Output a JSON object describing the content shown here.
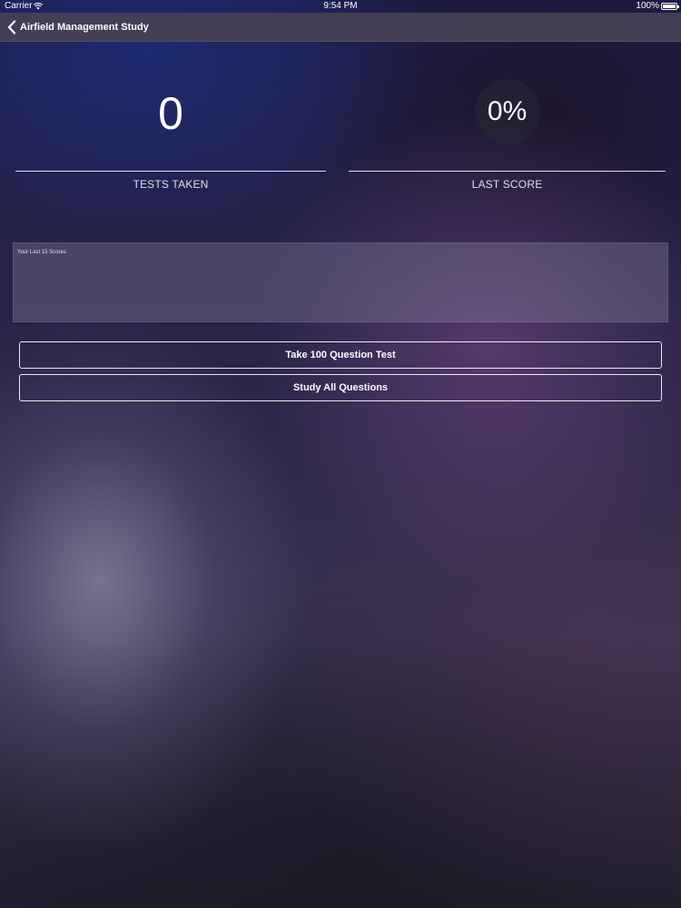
{
  "status_bar": {
    "carrier": "Carrier",
    "time": "9:54 PM",
    "battery": "100%"
  },
  "nav": {
    "back_label": "Airfield Management Study",
    "back_icon": "chevron-left-icon"
  },
  "stats": {
    "tests_taken_value": "0",
    "tests_taken_label": "TESTS TAKEN",
    "last_score_value": "0%",
    "last_score_label": "LAST SCORE"
  },
  "scores_panel": {
    "title": "Your Last 15 Scores"
  },
  "actions": {
    "take_test_label": "Take 100 Question Test",
    "study_label": "Study All Questions"
  }
}
